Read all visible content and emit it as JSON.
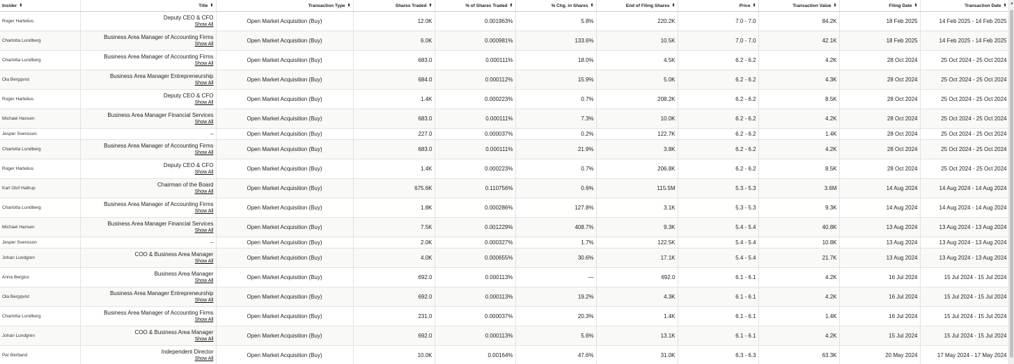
{
  "columns": [
    {
      "key": "insider",
      "label": "Insider"
    },
    {
      "key": "title",
      "label": "Title"
    },
    {
      "key": "type",
      "label": "Transaction Type"
    },
    {
      "key": "shares",
      "label": "Shares Traded"
    },
    {
      "key": "pct",
      "label": "% of Shares Traded"
    },
    {
      "key": "chg",
      "label": "% Chg. in Shares"
    },
    {
      "key": "end",
      "label": "End of Filing Shares"
    },
    {
      "key": "price",
      "label": "Price"
    },
    {
      "key": "value",
      "label": "Transaction Value"
    },
    {
      "key": "filing",
      "label": "Filing Date"
    },
    {
      "key": "tdate",
      "label": "Transaction Date"
    }
  ],
  "show_all_label": "Show All",
  "rows": [
    {
      "insider": "Roger Hartelius",
      "title": "Deputy CEO & CFO",
      "type": "Open Market Acquisition (Buy)",
      "shares": "12.0K",
      "pct": "0.001963%",
      "chg": "5.8%",
      "end": "220.2K",
      "price": "7.0 - 7.0",
      "value": "84.2K",
      "filing": "18 Feb 2025",
      "tdate": "14 Feb 2025 - 14 Feb 2025"
    },
    {
      "insider": "Charlotta Lundberg",
      "title": "Business Area Manager of Accounting Firms",
      "type": "Open Market Acquisition (Buy)",
      "shares": "6.0K",
      "pct": "0.000981%",
      "chg": "133.6%",
      "end": "10.5K",
      "price": "7.0 - 7.0",
      "value": "42.1K",
      "filing": "18 Feb 2025",
      "tdate": "14 Feb 2025 - 14 Feb 2025"
    },
    {
      "insider": "Charlotta Lundberg",
      "title": "Business Area Manager of Accounting Firms",
      "type": "Open Market Acquisition (Buy)",
      "shares": "683.0",
      "pct": "0.000111%",
      "chg": "18.0%",
      "end": "4.5K",
      "price": "6.2 - 6.2",
      "value": "4.2K",
      "filing": "28 Oct 2024",
      "tdate": "25 Oct 2024 - 25 Oct 2024"
    },
    {
      "insider": "Ola Bergqvist",
      "title": "Business Area Manager Entrepreneurship",
      "type": "Open Market Acquisition (Buy)",
      "shares": "684.0",
      "pct": "0.000112%",
      "chg": "15.9%",
      "end": "5.0K",
      "price": "6.2 - 6.2",
      "value": "4.3K",
      "filing": "28 Oct 2024",
      "tdate": "25 Oct 2024 - 25 Oct 2024"
    },
    {
      "insider": "Roger Hartelius",
      "title": "Deputy CEO & CFO",
      "type": "Open Market Acquisition (Buy)",
      "shares": "1.4K",
      "pct": "0.000223%",
      "chg": "0.7%",
      "end": "208.2K",
      "price": "6.2 - 6.2",
      "value": "8.5K",
      "filing": "28 Oct 2024",
      "tdate": "25 Oct 2024 - 25 Oct 2024"
    },
    {
      "insider": "Michael Hansen",
      "title": "Business Area Manager Financial Services",
      "type": "Open Market Acquisition (Buy)",
      "shares": "683.0",
      "pct": "0.000111%",
      "chg": "7.3%",
      "end": "10.0K",
      "price": "6.2 - 6.2",
      "value": "4.2K",
      "filing": "28 Oct 2024",
      "tdate": "25 Oct 2024 - 25 Oct 2024"
    },
    {
      "insider": "Jesper Svensson",
      "title": "–",
      "type": "Open Market Acquisition (Buy)",
      "shares": "227.0",
      "pct": "0.000037%",
      "chg": "0.2%",
      "end": "122.7K",
      "price": "6.2 - 6.2",
      "value": "1.4K",
      "filing": "28 Oct 2024",
      "tdate": "25 Oct 2024 - 25 Oct 2024"
    },
    {
      "insider": "Charlotta Lundberg",
      "title": "Business Area Manager of Accounting Firms",
      "type": "Open Market Acquisition (Buy)",
      "shares": "683.0",
      "pct": "0.000111%",
      "chg": "21.9%",
      "end": "3.8K",
      "price": "6.2 - 6.2",
      "value": "4.2K",
      "filing": "28 Oct 2024",
      "tdate": "25 Oct 2024 - 25 Oct 2024"
    },
    {
      "insider": "Roger Hartelius",
      "title": "Deputy CEO & CFO",
      "type": "Open Market Acquisition (Buy)",
      "shares": "1.4K",
      "pct": "0.000223%",
      "chg": "0.7%",
      "end": "206.8K",
      "price": "6.2 - 6.2",
      "value": "8.5K",
      "filing": "28 Oct 2024",
      "tdate": "25 Oct 2024 - 25 Oct 2024"
    },
    {
      "insider": "Karl Olof Hallrup",
      "title": "Chairman of the Board",
      "type": "Open Market Acquisition (Buy)",
      "shares": "675.6K",
      "pct": "0.110756%",
      "chg": "0.6%",
      "end": "115.5M",
      "price": "5.3 - 5.3",
      "value": "3.6M",
      "filing": "14 Aug 2024",
      "tdate": "14 Aug 2024 - 14 Aug 2024"
    },
    {
      "insider": "Charlotta Lundberg",
      "title": "Business Area Manager of Accounting Firms",
      "type": "Open Market Acquisition (Buy)",
      "shares": "1.8K",
      "pct": "0.000286%",
      "chg": "127.8%",
      "end": "3.1K",
      "price": "5.3 - 5.3",
      "value": "9.3K",
      "filing": "14 Aug 2024",
      "tdate": "14 Aug 2024 - 14 Aug 2024"
    },
    {
      "insider": "Michael Hansen",
      "title": "Business Area Manager Financial Services",
      "type": "Open Market Acquisition (Buy)",
      "shares": "7.5K",
      "pct": "0.001229%",
      "chg": "408.7%",
      "end": "9.3K",
      "price": "5.4 - 5.4",
      "value": "40.8K",
      "filing": "13 Aug 2024",
      "tdate": "13 Aug 2024 - 13 Aug 2024"
    },
    {
      "insider": "Jesper Svensson",
      "title": "–",
      "type": "Open Market Acquisition (Buy)",
      "shares": "2.0K",
      "pct": "0.000327%",
      "chg": "1.7%",
      "end": "122.5K",
      "price": "5.4 - 5.4",
      "value": "10.8K",
      "filing": "13 Aug 2024",
      "tdate": "13 Aug 2024 - 13 Aug 2024"
    },
    {
      "insider": "Johan Lundgren",
      "title": "COO & Business Area Manager",
      "type": "Open Market Acquisition (Buy)",
      "shares": "4.0K",
      "pct": "0.000655%",
      "chg": "30.6%",
      "end": "17.1K",
      "price": "5.4 - 5.4",
      "value": "21.7K",
      "filing": "13 Aug 2024",
      "tdate": "13 Aug 2024 - 13 Aug 2024"
    },
    {
      "insider": "Anna Bergius",
      "title": "Business Area Manager",
      "type": "Open Market Acquisition (Buy)",
      "shares": "692.0",
      "pct": "0.000113%",
      "chg": "—",
      "end": "692.0",
      "price": "6.1 - 6.1",
      "value": "4.2K",
      "filing": "16 Jul 2024",
      "tdate": "15 Jul 2024 - 15 Jul 2024"
    },
    {
      "insider": "Ola Bergqvist",
      "title": "Business Area Manager Entrepreneurship",
      "type": "Open Market Acquisition (Buy)",
      "shares": "692.0",
      "pct": "0.000113%",
      "chg": "19.2%",
      "end": "4.3K",
      "price": "6.1 - 6.1",
      "value": "4.2K",
      "filing": "16 Jul 2024",
      "tdate": "15 Jul 2024 - 15 Jul 2024"
    },
    {
      "insider": "Charlotta Lundberg",
      "title": "Business Area Manager of Accounting Firms",
      "type": "Open Market Acquisition (Buy)",
      "shares": "231.0",
      "pct": "0.000037%",
      "chg": "20.3%",
      "end": "1.4K",
      "price": "6.1 - 6.1",
      "value": "1.4K",
      "filing": "16 Jul 2024",
      "tdate": "15 Jul 2024 - 15 Jul 2024"
    },
    {
      "insider": "Johan Lundgren",
      "title": "COO & Business Area Manager",
      "type": "Open Market Acquisition (Buy)",
      "shares": "692.0",
      "pct": "0.000113%",
      "chg": "5.6%",
      "end": "13.1K",
      "price": "6.1 - 6.1",
      "value": "4.2K",
      "filing": "15 Jul 2024",
      "tdate": "15 Jul 2024 - 15 Jul 2024"
    },
    {
      "insider": "Per Bertland",
      "title": "Independent Director",
      "type": "Open Market Acquisition (Buy)",
      "shares": "10.0K",
      "pct": "0.00164%",
      "chg": "47.6%",
      "end": "31.0K",
      "price": "6.3 - 6.3",
      "value": "63.3K",
      "filing": "20 May 2024",
      "tdate": "17 May 2024 - 17 May 2024"
    }
  ]
}
